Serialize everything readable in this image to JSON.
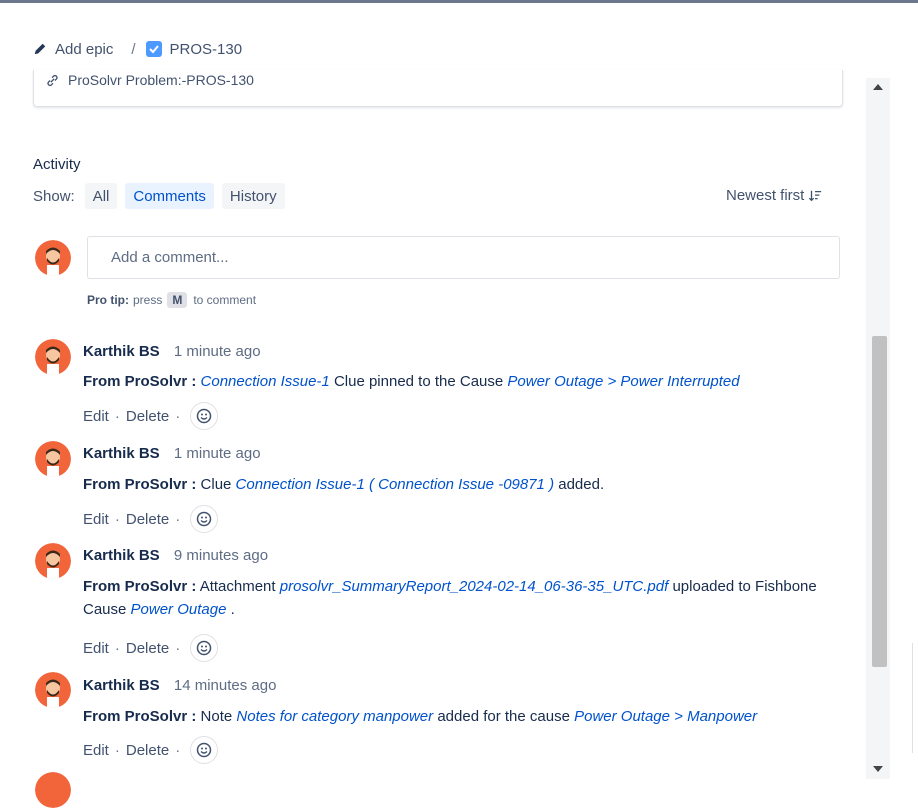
{
  "breadcrumb": {
    "add_epic": "Add epic",
    "separator": "/",
    "issue_key": "PROS-130"
  },
  "linked_item": {
    "text": "ProSolvr Problem:-PROS-130"
  },
  "activity": {
    "title": "Activity",
    "show_label": "Show:",
    "filters": [
      "All",
      "Comments",
      "History"
    ],
    "active_filter": "Comments",
    "sort_label": "Newest first"
  },
  "comment_box": {
    "placeholder": "Add a comment...",
    "protip_bold": "Pro tip:",
    "protip_pre": "press",
    "protip_key": "M",
    "protip_post": "to comment"
  },
  "comments": [
    {
      "author": "Karthik BS",
      "time": "1 minute ago",
      "source": "From ProSolvr :",
      "parts": [
        {
          "t": "link",
          "v": "Connection Issue-1"
        },
        {
          "t": "text",
          "v": " Clue pinned to the Cause "
        },
        {
          "t": "link",
          "v": "Power Outage > Power Interrupted"
        }
      ]
    },
    {
      "author": "Karthik BS",
      "time": "1 minute ago",
      "source": "From ProSolvr :",
      "parts": [
        {
          "t": "text",
          "v": " Clue "
        },
        {
          "t": "link",
          "v": "Connection Issue-1 ( Connection Issue -09871 )"
        },
        {
          "t": "text",
          "v": " added."
        }
      ]
    },
    {
      "author": "Karthik BS",
      "time": "9 minutes ago",
      "source": "From ProSolvr :",
      "parts": [
        {
          "t": "text",
          "v": " Attachment "
        },
        {
          "t": "link",
          "v": "prosolvr_SummaryReport_2024-02-14_06-36-35_UTC.pdf"
        },
        {
          "t": "text",
          "v": " uploaded to Fishbone Cause "
        },
        {
          "t": "link",
          "v": "Power Outage"
        },
        {
          "t": "text",
          "v": " ."
        }
      ]
    },
    {
      "author": "Karthik BS",
      "time": "14 minutes ago",
      "source": "From ProSolvr :",
      "parts": [
        {
          "t": "text",
          "v": " Note "
        },
        {
          "t": "link",
          "v": "Notes for category manpower"
        },
        {
          "t": "text",
          "v": " added for the cause "
        },
        {
          "t": "link",
          "v": "Power Outage > Manpower"
        }
      ]
    }
  ],
  "comment_actions": {
    "edit": "Edit",
    "delete": "Delete",
    "dot": "·"
  },
  "colors": {
    "link": "#0052cc",
    "active_filter_bg": "#e9f2ff",
    "avatar_bg": "#f2643a"
  },
  "icons": [
    "pencil-icon",
    "checkbox-icon",
    "link-icon",
    "sort-icon",
    "emoji-icon",
    "avatar"
  ]
}
